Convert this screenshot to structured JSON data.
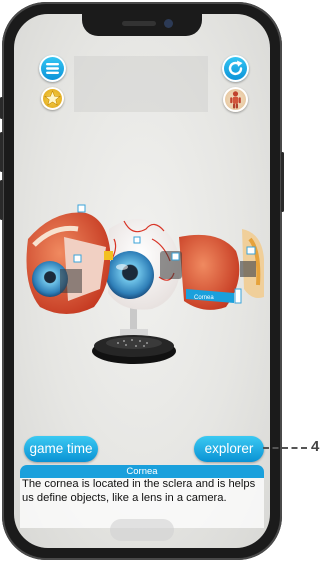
{
  "buttons": {
    "game_time_label": "game time",
    "explorer_label": "explorer"
  },
  "model": {
    "cornea_tag": "Cornea"
  },
  "info_panel": {
    "title": "Cornea",
    "text": "The cornea is located in the sclera and is helps us define objects, like a lens in a camera."
  },
  "callout": {
    "number": "4"
  },
  "icons": {
    "menu": "menu-icon",
    "refresh": "refresh-icon",
    "star": "star-icon",
    "body": "human-body-icon"
  },
  "colors": {
    "accent": "#0a92d4",
    "accent_light": "#3bc9f2"
  }
}
